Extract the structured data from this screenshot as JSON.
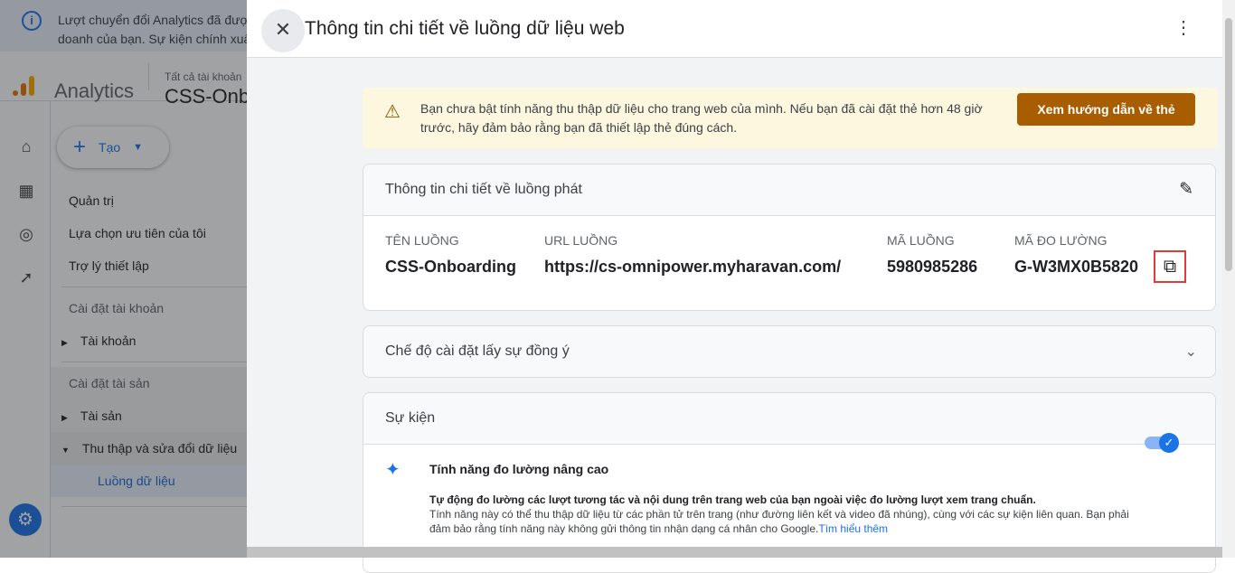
{
  "banner": {
    "text_line1": "Lượt chuyển đổi Analytics đã được",
    "text_line2": "doanh của bạn. Sự kiện chính xuấ"
  },
  "header": {
    "app_name": "Analytics",
    "account_label": "Tất cả tài khoản",
    "property": "CSS-Onb"
  },
  "nav": {
    "create_label": "Tạo",
    "items": [
      "Quản trị",
      "Lựa chọn ưu tiên của tôi",
      "Trợ lý thiết lập"
    ],
    "account_section": "Cài đặt tài khoản",
    "account_item": "Tài khoản",
    "property_section": "Cài đặt tài sản",
    "property_item": "Tài sản",
    "data_item": "Thu thập và sửa đổi dữ liệu",
    "streams_item": "Luồng dữ liệu"
  },
  "panel": {
    "title": "Thông tin chi tiết về luồng dữ liệu web",
    "warning": {
      "text": "Bạn chưa bật tính năng thu thập dữ liệu cho trang web của mình. Nếu bạn đã cài đặt thẻ hơn 48 giờ trước, hãy đảm bảo rằng bạn đã thiết lập thẻ đúng cách.",
      "button": "Xem hướng dẫn về thẻ"
    },
    "stream_details": {
      "title": "Thông tin chi tiết về luồng phát",
      "fields": [
        {
          "label": "TÊN LUỒNG",
          "value": "CSS-Onboarding"
        },
        {
          "label": "URL LUỒNG",
          "value": "https://cs-omnipower.myharavan.com/"
        },
        {
          "label": "MÃ LUỒNG",
          "value": "5980985286"
        },
        {
          "label": "MÃ ĐO LƯỜNG",
          "value": "G-W3MX0B5820"
        }
      ]
    },
    "consent": {
      "title": "Chế độ cài đặt lấy sự đồng ý"
    },
    "events": {
      "title": "Sự kiện",
      "enhanced_title": "Tính năng đo lường nâng cao",
      "enhanced_desc_bold": "Tự động đo lường các lượt tương tác và nội dung trên trang web của bạn ngoài việc đo lường lượt xem trang chuẩn.",
      "enhanced_desc": "Tính năng này có thể thu thập dữ liệu từ các phần tử trên trang (như đường liên kết và video đã nhúng), cùng với các sự kiện liên quan. Bạn phải đảm bảo rằng tính năng này không gửi thông tin nhận dạng cá nhân cho Google.",
      "learn_more": "Tìm hiểu thêm",
      "enabled": true
    }
  }
}
